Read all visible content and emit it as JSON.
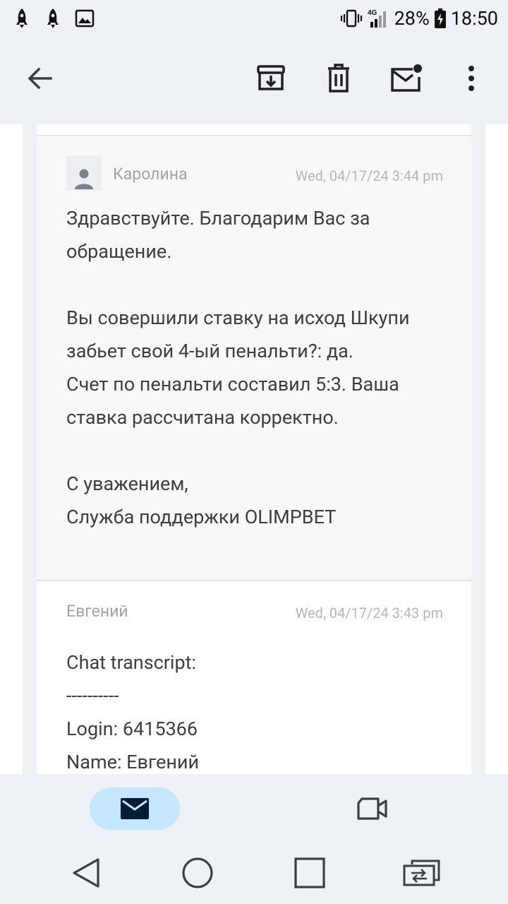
{
  "status_bar": {
    "left_icons": [
      "rocket-icon",
      "rocket-icon",
      "image-icon"
    ],
    "network": "4G",
    "battery": "28%",
    "time": "18:50"
  },
  "toolbar": {
    "icons": [
      "back-arrow-icon",
      "archive-icon",
      "trash-icon",
      "mark-unread-icon",
      "more-vert-icon"
    ]
  },
  "messages": [
    {
      "sender": "Каролина",
      "date": "Wed, 04/17/24 3:44 pm",
      "body": "Здравствуйте. Благодарим Вас за обращение.\n\nВы совершили ставку на исход Шкупи забьет свой 4-ый пенальти?: да.\nСчет по пенальти составил 5:3. Ваша ставка рассчитана корректно.\n\nС уважением,\nСлужба поддержки OLIMPBET"
    },
    {
      "sender": "Евгений",
      "date": "Wed, 04/17/24 3:43 pm",
      "body": "Chat transcript:\n----------\nLogin: 6415366\nName: Евгений"
    }
  ],
  "bottom_nav": {
    "items": [
      "mail-icon",
      "video-icon"
    ],
    "active": "mail"
  },
  "colors": {
    "chrome_bg": "#eef1f6",
    "active_pill": "#c4e7ff",
    "text_body": "#3c4043",
    "text_muted": "#a0a4a9"
  }
}
